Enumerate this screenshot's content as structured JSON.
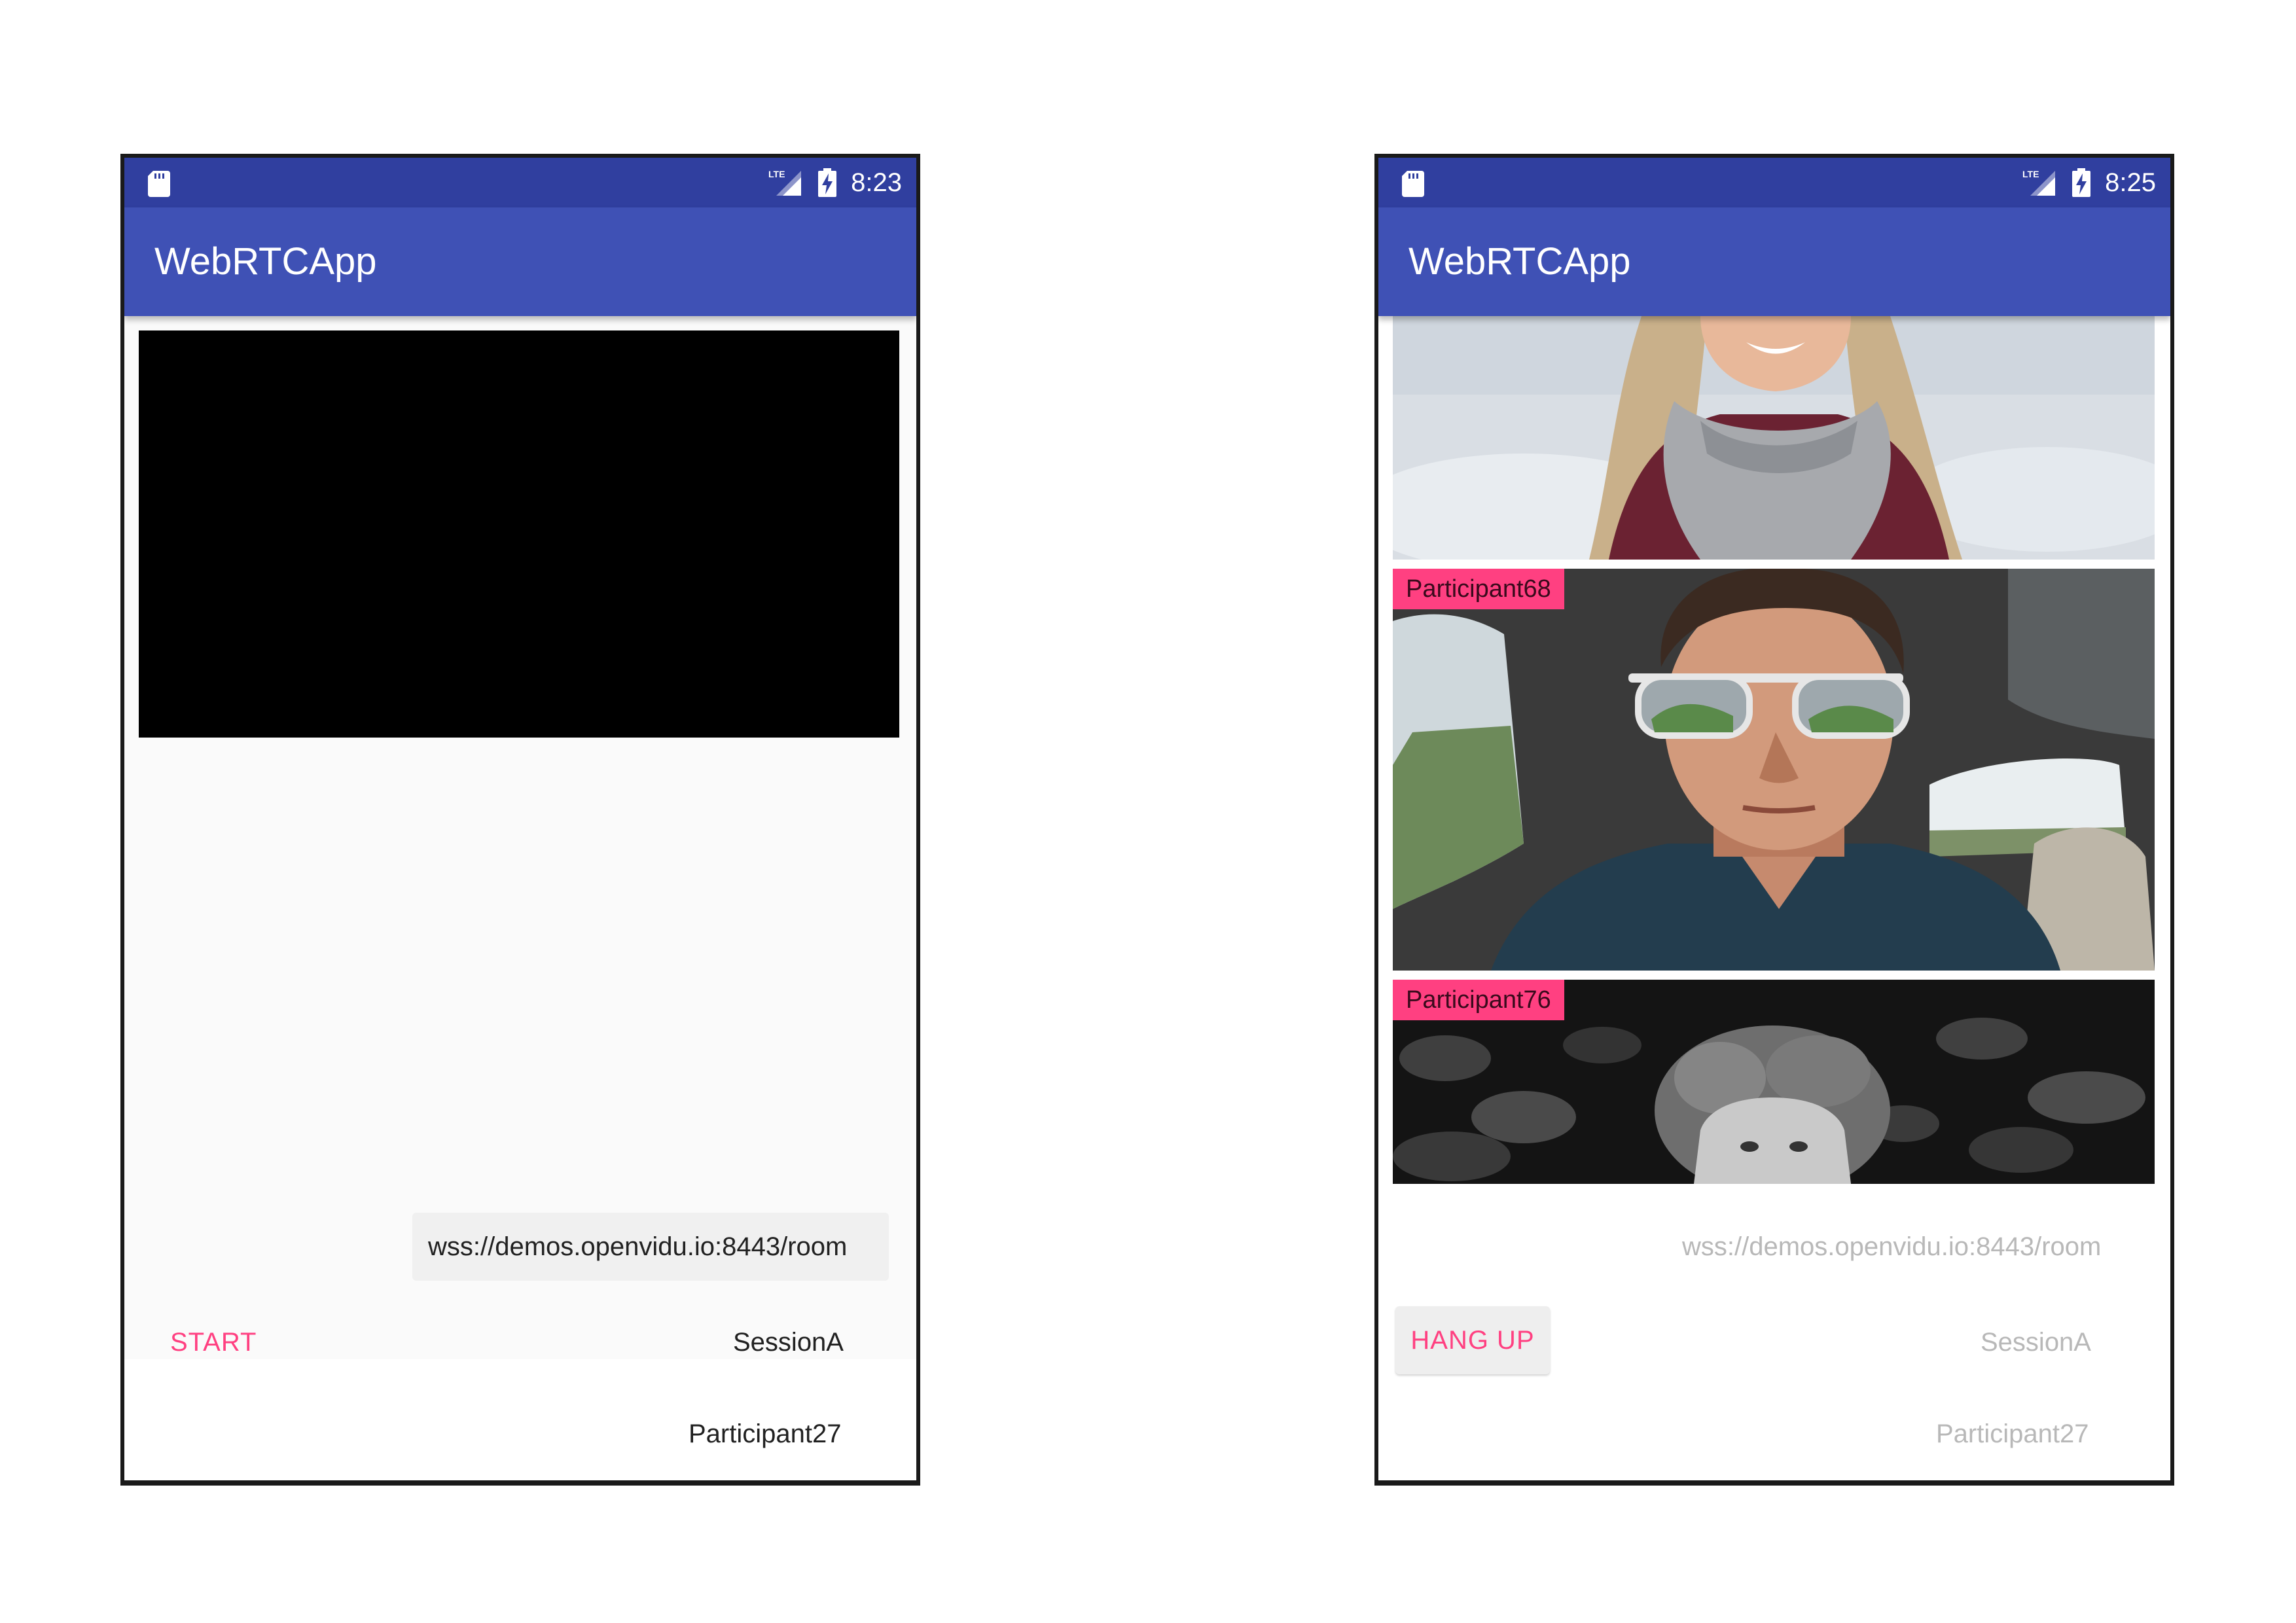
{
  "colors": {
    "status_bar": "#303f9f",
    "app_bar": "#3f51b5",
    "accent": "#ff4081",
    "video_off": "#000000",
    "content_bg": "#fafafa"
  },
  "left_phone": {
    "status_bar": {
      "sd_icon": "sd-card-icon",
      "signal_icon": "lte-signal-icon",
      "network_label": "LTE",
      "battery_icon": "battery-charging-icon",
      "time": "8:23"
    },
    "app_title": "WebRTCApp",
    "local_video": {
      "state": "black"
    },
    "url_input": {
      "value": "wss://demos.openvidu.io:8443/room"
    },
    "start_button": {
      "label": "START"
    },
    "session_input": {
      "value": "SessionA"
    },
    "participant_input": {
      "value": "Participant27"
    }
  },
  "right_phone": {
    "status_bar": {
      "sd_icon": "sd-card-icon",
      "signal_icon": "lte-signal-icon",
      "network_label": "LTE",
      "battery_icon": "battery-charging-icon",
      "time": "8:25"
    },
    "app_title": "WebRTCApp",
    "remote_videos": [
      {
        "label": "",
        "subject": "woman with scarf"
      },
      {
        "label": "Participant68",
        "subject": "man with sunglasses in car"
      },
      {
        "label": "Participant76",
        "subject": "young man black and white"
      }
    ],
    "url_input": {
      "value": "wss://demos.openvidu.io:8443/room"
    },
    "hangup_button": {
      "label": "HANG UP"
    },
    "session_input": {
      "value": "SessionA"
    },
    "participant_input": {
      "value": "Participant27"
    }
  }
}
